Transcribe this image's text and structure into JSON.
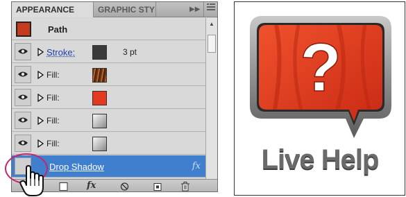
{
  "panel": {
    "tabs": [
      {
        "label": "APPEARANCE",
        "active": true
      },
      {
        "label": "GRAPHIC STY",
        "active": false
      }
    ],
    "menu_icons": [
      "forward-icon",
      "panel-menu-icon"
    ],
    "object_label": "Path",
    "rows": [
      {
        "label": "Stroke:",
        "swatch": "dark-gray",
        "value": "3 pt"
      },
      {
        "label": "Fill:",
        "swatch": "wood-pattern"
      },
      {
        "label": "Fill:",
        "swatch": "red"
      },
      {
        "label": "Fill:",
        "swatch": "gray-gradient"
      },
      {
        "label": "Fill:",
        "swatch": "gray-gradient"
      }
    ],
    "selected_effect": {
      "label": "Drop Shadow",
      "fx": "fx"
    },
    "bottom_buttons": [
      "new-stroke-icon",
      "fx",
      "clear-icon",
      "duplicate-icon",
      "trash-icon"
    ],
    "colors": {
      "selection": "#3f7fce",
      "highlight_circle": "#c4246f",
      "swatch_red": "#e2391f"
    }
  },
  "logo": {
    "question_mark": "?",
    "text": "Live Help",
    "colors": {
      "bubble": "#e03e23",
      "frame": "#8f8f8f",
      "text": "#6a6a6a"
    }
  }
}
